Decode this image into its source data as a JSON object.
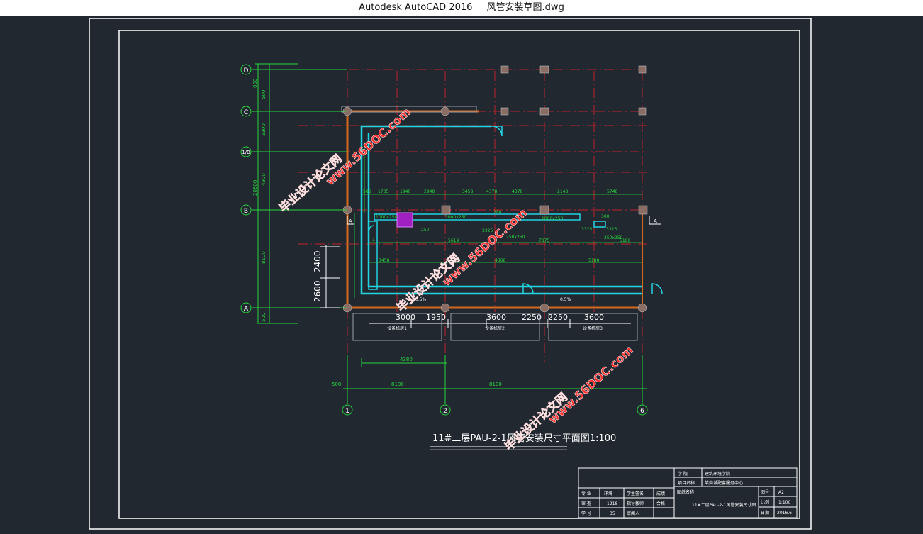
{
  "window": {
    "app_title": "Autodesk AutoCAD 2016",
    "file_name": "风管安装草图.dwg"
  },
  "drawing": {
    "title": "11#二层PAU-2-1风管安装尺寸平面图1:100",
    "axes_letters": [
      "D",
      "C",
      "1/B",
      "B",
      "A"
    ],
    "axes_numbers": [
      "1",
      "2",
      "6"
    ],
    "left_dims_outer": [
      "500",
      "3300",
      "4900",
      "8100",
      "500"
    ],
    "left_dims_mid": [
      "600",
      "20800"
    ],
    "left_dims_big": [
      "2400",
      "2600"
    ],
    "bottom_dims": [
      "3000",
      "1950",
      "3600",
      "2250",
      "2250",
      "3600"
    ],
    "lower_dims": [
      "500",
      "8100",
      "8100",
      "4380"
    ],
    "room_labels": [
      "设备机房1",
      "设备机房2",
      "设备机房3"
    ],
    "duct_texts": [
      "1000x250",
      "280",
      "1000x250",
      "300",
      "3325",
      "250",
      "1000x250",
      "250x250",
      "0.5%",
      "0.5%",
      "1",
      "4368",
      "3458",
      "7875",
      "5188",
      "5619",
      "1940",
      "2948",
      "3458",
      "4378",
      "2148",
      "5748",
      "586",
      "1735"
    ],
    "arrow_label_left": "A",
    "arrow_label_right": "A"
  },
  "title_block": {
    "r1_label": "学 院",
    "r1_value": "建筑环境学院",
    "r2_label": "项目名称",
    "r2_value": "某商城配套服务中心",
    "r3_label": "图纸名称",
    "r3_value": "11#二层PAU-2-1风管安装尺寸图",
    "major_label": "专 业",
    "major_value": "环境",
    "class_label": "审 查",
    "class_value": "1218",
    "id_label": "学 号",
    "id_value": "35",
    "sign1": "学生签名",
    "sign2": "指导教师",
    "sign3": "审阅人",
    "grade_label": "成绩",
    "grade_value": "合格",
    "sheet_label": "图号",
    "sheet_value": "A2",
    "scale_label": "比例",
    "scale_value": "1:100",
    "date_label": "日期",
    "date_value": "2016.6"
  },
  "watermarks": [
    "毕业设计论文网",
    "www.56DOC.com"
  ],
  "colors": {
    "background": "#212830",
    "frame": "#ffffff",
    "grid_red": "#c0202a",
    "dim_green": "#27d63c",
    "duct_cyan": "#22d3e0",
    "wall_orange": "#d2691e",
    "watermark_red": "#ff2a2a"
  }
}
